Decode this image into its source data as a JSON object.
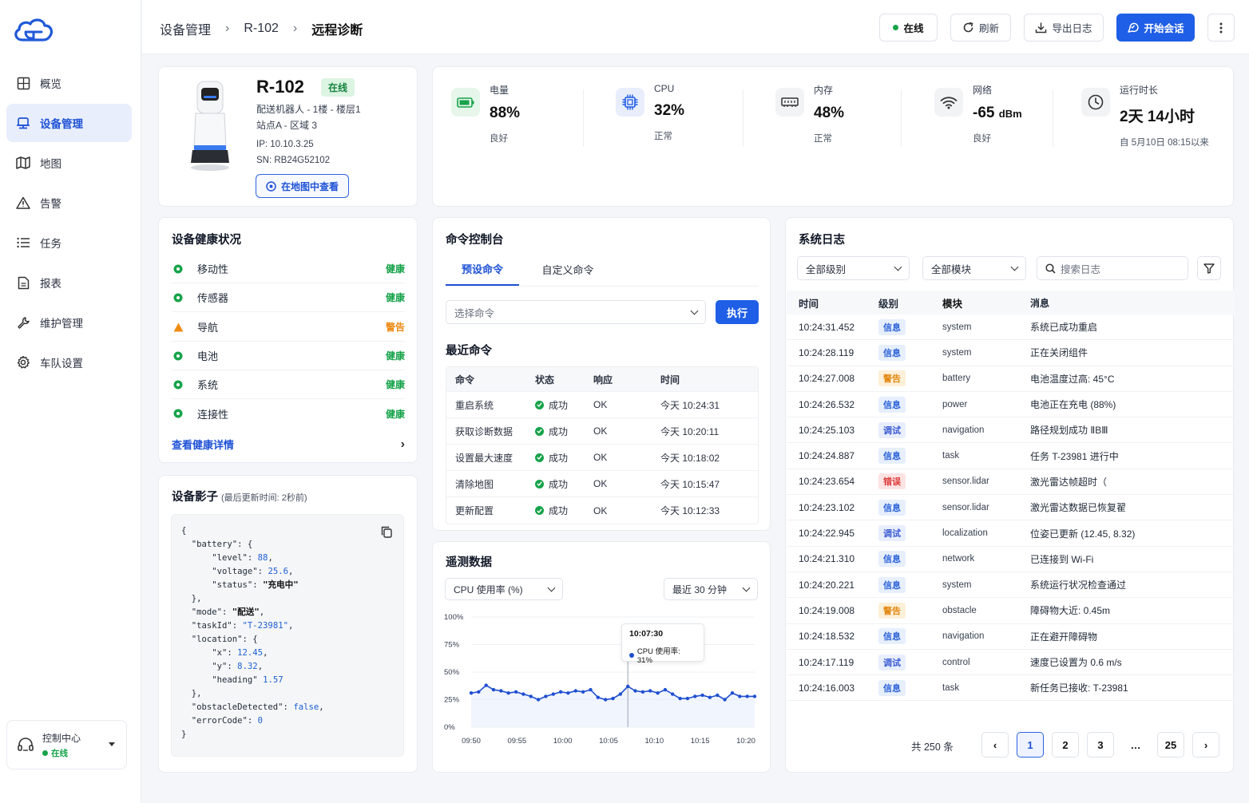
{
  "sidebar": {
    "items": [
      {
        "label": "概览",
        "icon": "dashboard-icon"
      },
      {
        "label": "设备管理",
        "icon": "device-icon",
        "active": true
      },
      {
        "label": "地图",
        "icon": "map-icon"
      },
      {
        "label": "告警",
        "icon": "warning-icon"
      },
      {
        "label": "任务",
        "icon": "list-icon"
      },
      {
        "label": "报表",
        "icon": "report-icon"
      },
      {
        "label": "维护管理",
        "icon": "wrench-icon"
      },
      {
        "label": "车队设置",
        "icon": "gear-icon"
      }
    ],
    "control_center": {
      "title": "控制中心",
      "status": "在线"
    }
  },
  "header": {
    "breadcrumb": [
      "设备管理",
      "R-102",
      "远程诊断"
    ],
    "status": "在线",
    "refresh": "刷新",
    "export": "导出日志",
    "start_session": "开始会话"
  },
  "device": {
    "name": "R-102",
    "badge": "在线",
    "type_line": "配送机器人 - 1楼 - 楼层1",
    "location_line": "站点A - 区域 3",
    "ip": "IP:  10.10.3.25",
    "sn": "SN:  RB24G52102",
    "map_button": "在地图中查看"
  },
  "metrics": [
    {
      "label": "电量",
      "value": "88%",
      "sub": "良好",
      "icon": "battery-icon",
      "color": "#16a34a"
    },
    {
      "label": "CPU",
      "value": "32%",
      "sub": "正常",
      "icon": "cpu-icon",
      "color": "#1f5ee6"
    },
    {
      "label": "内存",
      "value": "48%",
      "sub": "正常",
      "icon": "memory-icon",
      "color": "#333333"
    },
    {
      "label": "网络",
      "value": "-65",
      "unit": "dBm",
      "sub": "良好",
      "icon": "wifi-icon",
      "color": "#333333"
    },
    {
      "label": "运行时长",
      "value": "2天 14小时",
      "sub": "自 5月10日 08:15以来",
      "icon": "clock-icon",
      "color": "#333333"
    }
  ],
  "health": {
    "title": "设备健康状况",
    "items": [
      {
        "name": "移动性",
        "status": "健康",
        "level": "ok"
      },
      {
        "name": "传感器",
        "status": "健康",
        "level": "ok"
      },
      {
        "name": "导航",
        "status": "警告",
        "level": "warn"
      },
      {
        "name": "电池",
        "status": "健康",
        "level": "ok"
      },
      {
        "name": "系统",
        "status": "健康",
        "level": "ok"
      },
      {
        "name": "连接性",
        "status": "健康",
        "level": "ok"
      }
    ],
    "link": "查看健康详情"
  },
  "shadow": {
    "title": "设备影子",
    "subtitle": "(最后更新时间: 2秒前)",
    "battery_level": "88",
    "battery_voltage": "25.6",
    "battery_status": "\"充电中\"",
    "mode": "\"配送\"",
    "task_id": "\"T-23981\"",
    "loc_x": "12.45",
    "loc_y": "8.32",
    "heading": "1.57",
    "obstacle": "false",
    "error_code": "0"
  },
  "console": {
    "title": "命令控制台",
    "tabs": [
      "预设命令",
      "自定义命令"
    ],
    "select_placeholder": "选择命令",
    "execute": "执行",
    "recent_title": "最近命令",
    "columns": [
      "命令",
      "状态",
      "响应",
      "时间"
    ],
    "rows": [
      [
        "重启系统",
        "成功",
        "OK",
        "今天 10:24:31"
      ],
      [
        "获取诊断数据",
        "成功",
        "OK",
        "今天 10:20:11"
      ],
      [
        "设置最大速度",
        "成功",
        "OK",
        "今天 10:18:02"
      ],
      [
        "清除地图",
        "成功",
        "OK",
        "今天 10:15:47"
      ],
      [
        "更新配置",
        "成功",
        "OK",
        "今天 10:12:33"
      ]
    ]
  },
  "telemetry": {
    "title": "遥测数据",
    "metric_select": "CPU 使用率 (%)",
    "range_select": "最近 30 分钟",
    "tooltip_time": "10:07:30",
    "tooltip_value": "CPU 使用率: 31%"
  },
  "chart_data": {
    "type": "line",
    "title": "",
    "xlabel": "",
    "ylabel": "",
    "x_ticks": [
      "09:50",
      "09:55",
      "10:00",
      "10:05",
      "10:10",
      "10:15",
      "10:20"
    ],
    "y_ticks": [
      "0%",
      "25%",
      "50%",
      "75%",
      "100%"
    ],
    "ylim": [
      0,
      100
    ],
    "series": [
      {
        "values": [
          31,
          32,
          38,
          34,
          33,
          31,
          32,
          30,
          28,
          25,
          28,
          30,
          32,
          31,
          33,
          32,
          34,
          27,
          25,
          26,
          30,
          37,
          33,
          32,
          33,
          31,
          34,
          30,
          26,
          26,
          28,
          29,
          27,
          29,
          25,
          31,
          28,
          28,
          28
        ]
      }
    ],
    "color": "#1f4fd0"
  },
  "logs": {
    "title": "系统日志",
    "level_filter": "全部级别",
    "module_filter": "全部模块",
    "search_placeholder": "搜索日志",
    "columns": [
      "时间",
      "级别",
      "模块",
      "消息"
    ],
    "rows": [
      [
        "10:24:31.452",
        "信息",
        "system",
        "系统已成功重启",
        "info"
      ],
      [
        "10:24:28.119",
        "信息",
        "system",
        "正在关闭组件",
        "info"
      ],
      [
        "10:24:27.008",
        "警告",
        "battery",
        "电池温度过高: 45°C",
        "warn"
      ],
      [
        "10:24:26.532",
        "信息",
        "power",
        "电池正在充电 (88%)",
        "info"
      ],
      [
        "10:24:25.103",
        "调试",
        "navigation",
        "路径规划成功 ⅡBⅢ",
        "debug"
      ],
      [
        "10:24:24.887",
        "信息",
        "task",
        "任务 T-23981 进行中",
        "info"
      ],
      [
        "10:24:23.654",
        "错误",
        "sensor.lidar",
        "激光雷达帧超时（",
        "error"
      ],
      [
        "10:24:23.102",
        "信息",
        "sensor.lidar",
        "激光雷达数据已恢复翟",
        "info"
      ],
      [
        "10:24:22.945",
        "调试",
        "localization",
        "位姿已更新 (12.45, 8.32)",
        "debug"
      ],
      [
        "10:24:21.310",
        "信息",
        "network",
        "已连接到 Wi-Fi",
        "info"
      ],
      [
        "10:24:20.221",
        "信息",
        "system",
        "系统运行状况检查通过",
        "info"
      ],
      [
        "10:24:19.008",
        "警告",
        "obstacle",
        "障碍物大近: 0.45m",
        "warn"
      ],
      [
        "10:24:18.532",
        "信息",
        "navigation",
        "正在避开障碍物",
        "info"
      ],
      [
        "10:24:17.119",
        "调试",
        "control",
        "速度已设置为 0.6 m/s",
        "debug"
      ],
      [
        "10:24:16.003",
        "信息",
        "task",
        "新任务已接收: T-23981",
        "info"
      ]
    ],
    "total": "共 250 条",
    "pages": [
      "1",
      "2",
      "3",
      "…",
      "25"
    ]
  }
}
